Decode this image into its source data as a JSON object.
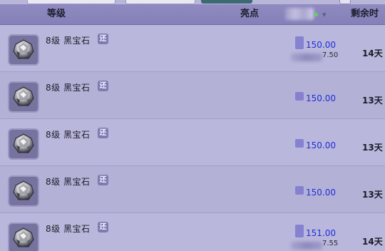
{
  "header": {
    "grade_label": "等级",
    "highlight_label": "亮点",
    "remain_label": "剩余时间"
  },
  "items": [
    {
      "name": "8级  黑宝石",
      "tag": "还",
      "price": "150.00",
      "sub_price": "7.50",
      "remain": "14天"
    },
    {
      "name": "8级  黑宝石",
      "tag": "还",
      "price": "150.00",
      "sub_price": "",
      "remain": "13天"
    },
    {
      "name": "8级  黑宝石",
      "tag": "还",
      "price": "150.00",
      "sub_price": "",
      "remain": "13天"
    },
    {
      "name": "8级  黑宝石",
      "tag": "还",
      "price": "150.00",
      "sub_price": "",
      "remain": "13天"
    },
    {
      "name": "8级  黑宝石",
      "tag": "还",
      "price": "151.00",
      "sub_price": "7.55",
      "remain": "14天"
    }
  ],
  "colors": {
    "accent_price": "#1f2ed8",
    "header_bg": "#8a86bd"
  }
}
